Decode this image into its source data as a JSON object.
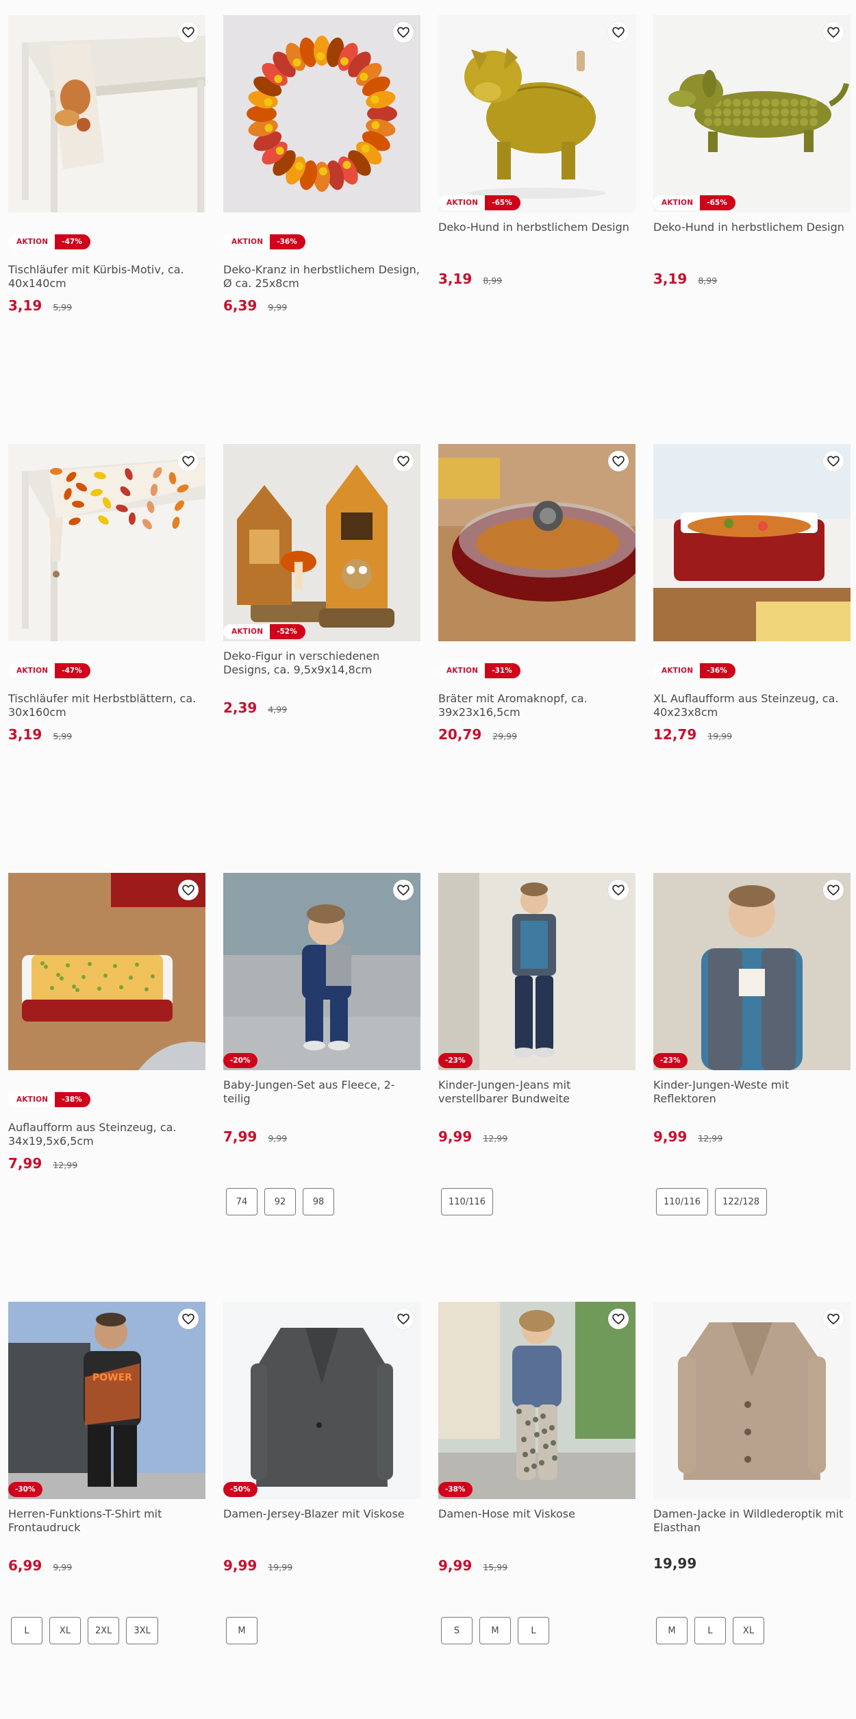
{
  "colors": {
    "sale_red": "#c8102e",
    "badge_red": "#d0021b",
    "text": "#4a4a4a"
  },
  "products": [
    {
      "aktion": "AKTION",
      "discount": "-47%",
      "title": "Tischläufer mit Kürbis-Motiv, ca. 40x140cm",
      "price": "3,19",
      "old_price": "5,99",
      "sizes": [],
      "image": "table-runner-pumpkin"
    },
    {
      "aktion": "AKTION",
      "discount": "-36%",
      "title": "Deko-Kranz in herbstlichem Design, Ø ca. 25x8cm",
      "price": "6,39",
      "old_price": "9,99",
      "sizes": [],
      "image": "autumn-wreath"
    },
    {
      "aktion": "AKTION",
      "discount": "-65%",
      "title": "Deko-Hund in herbstlichem Design",
      "price": "3,19",
      "old_price": "8,99",
      "sizes": [],
      "image": "pumpkin-bulldog"
    },
    {
      "aktion": "AKTION",
      "discount": "-65%",
      "title": "Deko-Hund in herbstlichem Design",
      "price": "3,19",
      "old_price": "8,99",
      "sizes": [],
      "image": "corn-dachshund"
    },
    {
      "aktion": "AKTION",
      "discount": "-47%",
      "title": "Tischläufer mit Herbstblättern, ca. 30x160cm",
      "price": "3,19",
      "old_price": "5,99",
      "sizes": [],
      "image": "table-runner-leaves"
    },
    {
      "aktion": "AKTION",
      "discount": "-52%",
      "title": "Deko-Figur in verschiedenen Designs, ca. 9,5x9x14,8cm",
      "price": "2,39",
      "old_price": "4,99",
      "sizes": [],
      "image": "deco-houses"
    },
    {
      "aktion": "AKTION",
      "discount": "-31%",
      "title": "Bräter mit Aromaknopf, ca. 39x23x16,5cm",
      "price": "20,79",
      "old_price": "29,99",
      "sizes": [],
      "image": "roaster"
    },
    {
      "aktion": "AKTION",
      "discount": "-36%",
      "title": "XL Auflaufform aus Steinzeug, ca. 40x23x8cm",
      "price": "12,79",
      "old_price": "19,99",
      "sizes": [],
      "image": "casserole-xl"
    },
    {
      "aktion": "AKTION",
      "discount": "-38%",
      "title": "Auflaufform aus Steinzeug, ca. 34x19,5x6,5cm",
      "price": "7,99",
      "old_price": "12,99",
      "sizes": [],
      "image": "casserole"
    },
    {
      "aktion": "",
      "discount": "-20%",
      "title": "Baby-Jungen-Set aus Fleece, 2-teilig",
      "price": "7,99",
      "old_price": "9,99",
      "sizes": [
        "74",
        "92",
        "98"
      ],
      "image": "baby-fleece-set"
    },
    {
      "aktion": "",
      "discount": "-23%",
      "title": "Kinder-Jungen-Jeans mit verstellbarer Bundweite",
      "price": "9,99",
      "old_price": "12,99",
      "sizes": [
        "110/116"
      ],
      "image": "boy-jeans"
    },
    {
      "aktion": "",
      "discount": "-23%",
      "title": "Kinder-Jungen-Weste mit Reflektoren",
      "price": "9,99",
      "old_price": "12,99",
      "sizes": [
        "110/116",
        "122/128"
      ],
      "image": "boy-vest"
    },
    {
      "aktion": "",
      "discount": "-30%",
      "title": "Herren-Funktions-T-Shirt mit Frontaudruck",
      "price": "6,99",
      "old_price": "9,99",
      "sizes": [
        "L",
        "XL",
        "2XL",
        "3XL"
      ],
      "image": "men-tshirt",
      "print_text": "POWER"
    },
    {
      "aktion": "",
      "discount": "-50%",
      "title": "Damen-Jersey-Blazer mit Viskose",
      "price": "9,99",
      "old_price": "19,99",
      "sizes": [
        "M"
      ],
      "image": "women-blazer"
    },
    {
      "aktion": "",
      "discount": "-38%",
      "title": "Damen-Hose mit Viskose",
      "price": "9,99",
      "old_price": "15,99",
      "sizes": [
        "S",
        "M",
        "L"
      ],
      "image": "women-trousers"
    },
    {
      "aktion": "",
      "discount": "",
      "title": "Damen-Jacke in Wildlederoptik mit Elasthan",
      "price": "19,99",
      "old_price": "",
      "sizes": [
        "M",
        "L",
        "XL"
      ],
      "image": "women-suede-jacket"
    }
  ]
}
